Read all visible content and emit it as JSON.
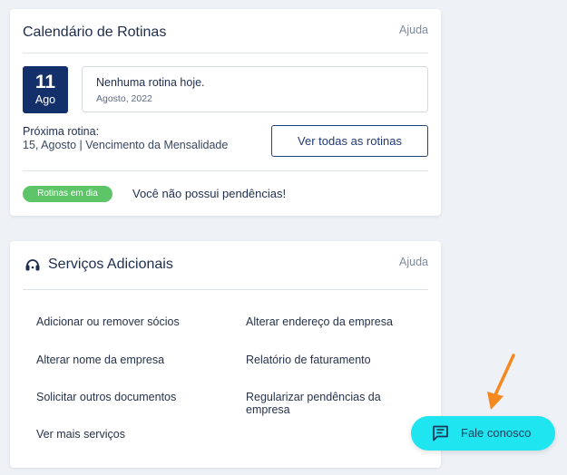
{
  "routines_card": {
    "title": "Calendário de Rotinas",
    "help": "Ajuda",
    "date_day": "11",
    "date_month": "Ago",
    "today_title": "Nenhuma rotina hoje.",
    "today_date": "Agosto, 2022",
    "next_label": "Próxima rotina:",
    "next_value": "15, Agosto | Vencimento da Mensalidade",
    "all_routines_button": "Ver todas as rotinas",
    "status_badge": "Rotinas em dia",
    "status_text": "Você não possui pendências!"
  },
  "services_card": {
    "title": "Serviços Adicionais",
    "help": "Ajuda",
    "icon": "headset-icon",
    "links": [
      "Adicionar ou remover sócios",
      "Alterar endereço da empresa",
      "Alterar nome da empresa",
      "Relatório de faturamento",
      "Solicitar outros documentos",
      "Regularizar pendências da empresa",
      "Ver mais serviços"
    ]
  },
  "contact_button": {
    "label": "Fale conosco",
    "icon": "chat-icon"
  },
  "annotation": {
    "icon": "arrow-pointer-icon",
    "color": "#f5891f"
  },
  "colors": {
    "primary": "#14306b",
    "success": "#5dc567",
    "contact": "#1ee5ef",
    "background": "#eef2f7"
  }
}
